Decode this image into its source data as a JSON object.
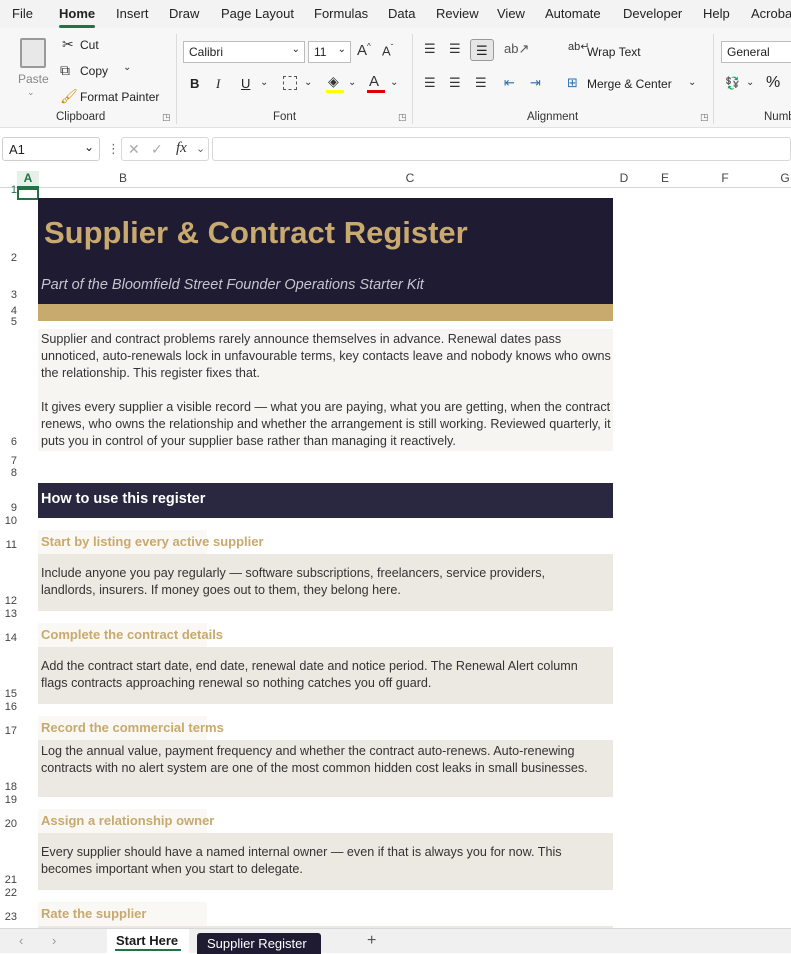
{
  "menu": [
    "File",
    "Home",
    "Insert",
    "Draw",
    "Page Layout",
    "Formulas",
    "Data",
    "Review",
    "View",
    "Automate",
    "Developer",
    "Help",
    "Acroba"
  ],
  "clipboard": {
    "paste": "Paste",
    "cut": "Cut",
    "copy": "Copy",
    "format_painter": "Format Painter",
    "label": "Clipboard"
  },
  "font": {
    "name": "Calibri",
    "size": "11",
    "bold": "B",
    "italic": "I",
    "underline": "U",
    "label": "Font",
    "fill_color": "#ffff00",
    "font_color": "#e00000"
  },
  "alignment": {
    "wrap": "Wrap Text",
    "merge": "Merge & Center",
    "label": "Alignment"
  },
  "number": {
    "format": "General",
    "percent": "%",
    "label": "Numb"
  },
  "formula_bar": {
    "cell_ref": "A1",
    "fx": "fx",
    "content": ""
  },
  "columns": [
    "A",
    "B",
    "C",
    "D",
    "E",
    "F",
    "G"
  ],
  "rows": [
    "1",
    "2",
    "3",
    "4",
    "5",
    "6",
    "7",
    "8",
    "9",
    "10",
    "11",
    "12",
    "13",
    "14",
    "15",
    "16",
    "17",
    "18",
    "19",
    "20",
    "21",
    "22",
    "23"
  ],
  "sheet": {
    "title": "Supplier & Contract Register",
    "subtitle": "Part of the Bloomfield Street Founder Operations Starter Kit",
    "intro_p1": "Supplier and contract problems rarely announce themselves in advance. Renewal dates pass unnoticed, auto-renewals lock in unfavourable terms, key contacts leave and nobody knows who owns the relationship. This register fixes that.",
    "intro_p2": "It gives every supplier a visible record — what you are paying, what you are getting, when the contract renews, who owns the relationship and whether the arrangement is still working. Reviewed quarterly, it puts you in control of your supplier base rather than managing it reactively.",
    "howto": "How to use this register",
    "steps": [
      {
        "heading": "Start by listing every active supplier",
        "body": "Include anyone you pay regularly — software subscriptions, freelancers, service providers, landlords, insurers. If money goes out to them, they belong here."
      },
      {
        "heading": "Complete the contract details",
        "body": "Add the contract start date, end date, renewal date and notice period. The Renewal Alert column flags contracts approaching renewal so nothing catches you off guard."
      },
      {
        "heading": "Record the commercial terms",
        "body": "Log the annual value, payment frequency and whether the contract auto-renews. Auto-renewing contracts with no alert system are one of the most common hidden cost leaks in small businesses."
      },
      {
        "heading": "Assign a relationship owner",
        "body": "Every supplier should have a named internal owner — even if that is always you for now. This becomes important when you start to delegate."
      },
      {
        "heading": "Rate the supplier",
        "body": ""
      }
    ]
  },
  "tabs": {
    "active": "Start Here",
    "other": "Supplier Register",
    "add": "+"
  },
  "colors": {
    "navy": "#1e1b33",
    "gold": "#c8a96e",
    "paper": "#f7f5f1",
    "step_bg": "#ece9e2",
    "excel_green": "#217346"
  }
}
